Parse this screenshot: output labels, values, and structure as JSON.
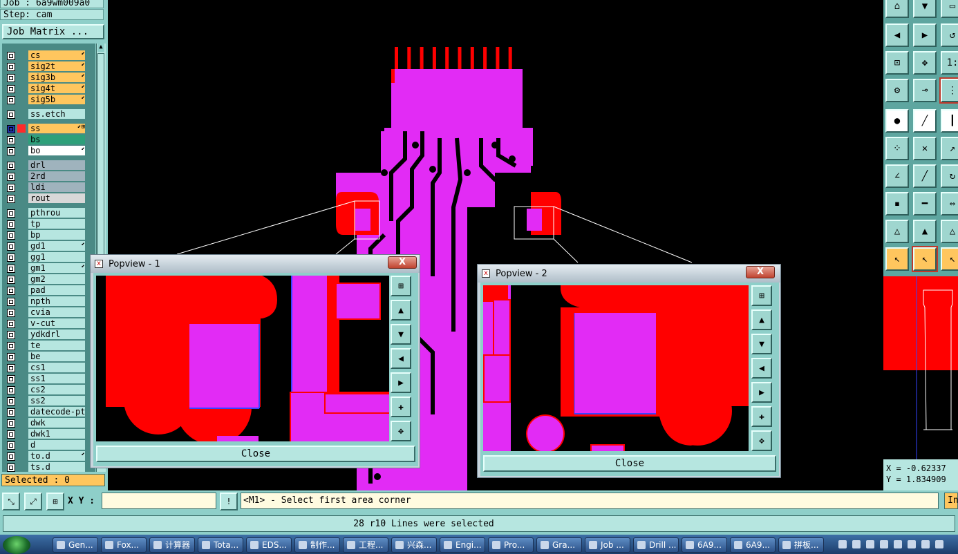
{
  "job_header": "Job : 6a9wm009a0",
  "step_header": "Step: cam",
  "job_matrix_label": "Job Matrix ...",
  "layers": [
    {
      "name": "cs",
      "color": "#ffc65e",
      "flag": "⬋"
    },
    {
      "name": "sig2t",
      "color": "#ffc65e",
      "flag": "⬋"
    },
    {
      "name": "sig3b",
      "color": "#ffc65e",
      "flag": "⬋"
    },
    {
      "name": "sig4t",
      "color": "#ffc65e",
      "flag": "⬋"
    },
    {
      "name": "sig5b",
      "color": "#ffc65e",
      "flag": "⬋"
    },
    {
      "name": "ss.etch",
      "color": "#b6e6e0",
      "flag": ""
    },
    {
      "name": "ss",
      "color": "#ffc65e",
      "flag": "⬋⊞",
      "active": true
    },
    {
      "name": "bs",
      "color": "#2ea07a",
      "flag": ""
    },
    {
      "name": "bo",
      "color": "#ffffff",
      "flag": "⬋"
    },
    {
      "name": "drl",
      "color": "#9fb3bd",
      "flag": ""
    },
    {
      "name": "2rd",
      "color": "#9fb3bd",
      "flag": ""
    },
    {
      "name": "ldi",
      "color": "#9fb3bd",
      "flag": ""
    },
    {
      "name": "rout",
      "color": "#d8d8d8",
      "flag": ""
    },
    {
      "name": "pthrou",
      "color": "#b6e6e0",
      "flag": ""
    },
    {
      "name": "tp",
      "color": "#b6e6e0",
      "flag": ""
    },
    {
      "name": "bp",
      "color": "#b6e6e0",
      "flag": ""
    },
    {
      "name": "gd1",
      "color": "#b6e6e0",
      "flag": "⬋"
    },
    {
      "name": "gg1",
      "color": "#b6e6e0",
      "flag": ""
    },
    {
      "name": "gm1",
      "color": "#b6e6e0",
      "flag": "⬋"
    },
    {
      "name": "gm2",
      "color": "#b6e6e0",
      "flag": ""
    },
    {
      "name": "pad",
      "color": "#b6e6e0",
      "flag": ""
    },
    {
      "name": "npth",
      "color": "#b6e6e0",
      "flag": ""
    },
    {
      "name": "cvia",
      "color": "#b6e6e0",
      "flag": ""
    },
    {
      "name": "v-cut",
      "color": "#b6e6e0",
      "flag": ""
    },
    {
      "name": "ydkdrl",
      "color": "#b6e6e0",
      "flag": ""
    },
    {
      "name": "te",
      "color": "#b6e6e0",
      "flag": ""
    },
    {
      "name": "be",
      "color": "#b6e6e0",
      "flag": ""
    },
    {
      "name": "cs1",
      "color": "#b6e6e0",
      "flag": ""
    },
    {
      "name": "ss1",
      "color": "#b6e6e0",
      "flag": ""
    },
    {
      "name": "cs2",
      "color": "#b6e6e0",
      "flag": ""
    },
    {
      "name": "ss2",
      "color": "#b6e6e0",
      "flag": ""
    },
    {
      "name": "datecode-ptc",
      "color": "#b6e6e0",
      "flag": ""
    },
    {
      "name": "dwk",
      "color": "#b6e6e0",
      "flag": ""
    },
    {
      "name": "dwk1",
      "color": "#b6e6e0",
      "flag": ""
    },
    {
      "name": "d",
      "color": "#b6e6e0",
      "flag": ""
    },
    {
      "name": "to.d",
      "color": "#b6e6e0",
      "flag": "⬋"
    },
    {
      "name": "ts.d",
      "color": "#b6e6e0",
      "flag": ""
    }
  ],
  "selected_label": "Selected : 0",
  "xy_label": "X Y :",
  "prompt_text": "<M1> - Select first area corner",
  "right_button_label": "In",
  "status_text": "28 r10 Lines were selected",
  "coord_text": "X = -0.62337\nY = 1.834909",
  "colors": {
    "copper": "#e22bf5",
    "mask": "#ff0000",
    "panel": "#8ecfc9",
    "highlight": "#ffc65e"
  },
  "popview1": {
    "title": "Popview - 1",
    "close_x": "X",
    "close_label": "Close"
  },
  "popview2": {
    "title": "Popview - 2",
    "close_x": "X",
    "close_label": "Close"
  },
  "taskbar": [
    {
      "label": "Gen...",
      "icon": "gen-icon"
    },
    {
      "label": "Fox...",
      "icon": "fox-icon"
    },
    {
      "label": "计算器",
      "icon": "calculator-icon"
    },
    {
      "label": "Tota...",
      "icon": "disk-icon"
    },
    {
      "label": "EDS...",
      "icon": "eds-icon"
    },
    {
      "label": "制作...",
      "icon": "doc-icon"
    },
    {
      "label": "工程...",
      "icon": "excel-icon"
    },
    {
      "label": "兴森...",
      "icon": "star-icon"
    },
    {
      "label": "Engi...",
      "icon": "window-icon"
    },
    {
      "label": "Pro...",
      "icon": "window-icon"
    },
    {
      "label": "Gra...",
      "icon": "window-icon"
    },
    {
      "label": "Job ...",
      "icon": "window-icon"
    },
    {
      "label": "Drill ...",
      "icon": "window-icon"
    },
    {
      "label": "6A9...",
      "icon": "excel-icon"
    },
    {
      "label": "6A9...",
      "icon": "excel-icon"
    },
    {
      "label": "拼板...",
      "icon": "pdf-icon"
    }
  ]
}
